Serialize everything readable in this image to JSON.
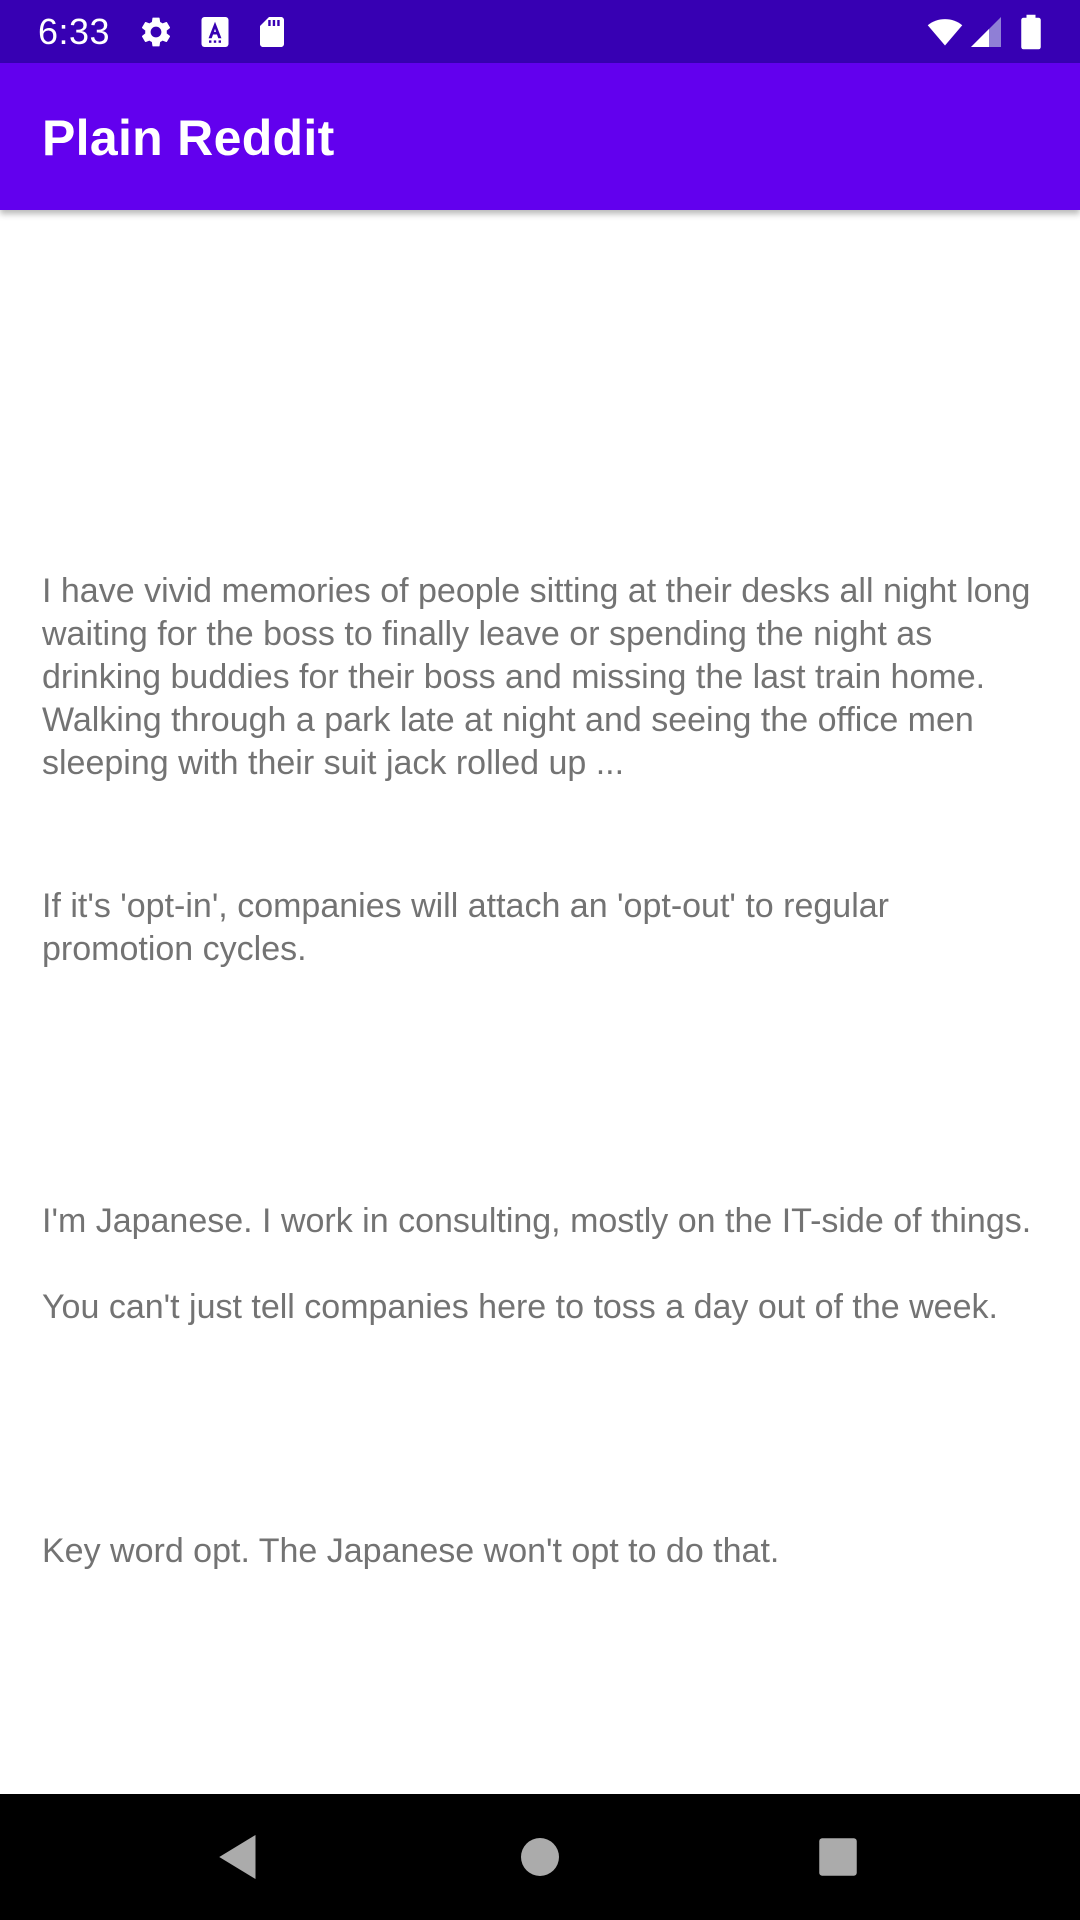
{
  "status_bar": {
    "time": "6:33",
    "left_icons": [
      "gear-icon",
      "text-a-icon",
      "sd-card-icon"
    ],
    "right_icons": [
      "wifi-icon",
      "cellular-signal-icon",
      "battery-icon"
    ],
    "background": "#3700b3"
  },
  "app_bar": {
    "title": "Plain Reddit",
    "background": "#6200ee"
  },
  "comments": [
    {
      "text": "I have vivid memories of people sitting at their desks all night long waiting for the boss to finally leave or spending the night as drinking buddies for their boss and missing the last train home.  Walking through a park late at night and seeing the office men sleeping with their suit jack rolled up ..."
    },
    {
      "text": "If it's 'opt-in', companies will attach an 'opt-out' to regular promotion cycles."
    },
    {
      "text": "I'm Japanese. I work in consulting, mostly on the IT-side of things.\n\nYou can't just tell companies here to toss a day out of the week."
    },
    {
      "text": "Key word opt. The Japanese won't opt to do that."
    }
  ],
  "nav_bar": {
    "buttons": [
      "back-icon",
      "home-icon",
      "recents-icon"
    ]
  },
  "colors": {
    "comment_text": "#737373",
    "nav_background": "#000000",
    "nav_icon": "#ababab"
  }
}
